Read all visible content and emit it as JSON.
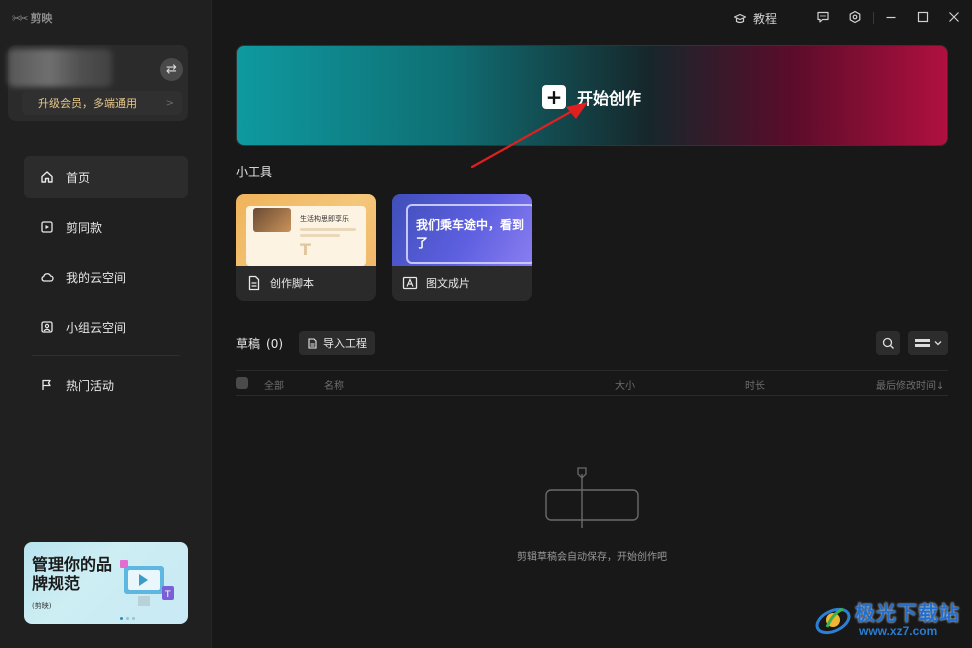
{
  "app": {
    "title": "剪映"
  },
  "account": {
    "upgrade_label": "升级会员，多端通用",
    "upgrade_chevron": ">",
    "switch_symbol": "⇄"
  },
  "nav": {
    "items": [
      {
        "label": "首页",
        "icon": "home-icon",
        "active": true
      },
      {
        "label": "剪同款",
        "icon": "template-icon",
        "active": false
      },
      {
        "label": "我的云空间",
        "icon": "cloud-icon",
        "active": false
      },
      {
        "label": "小组云空间",
        "icon": "group-cloud-icon",
        "active": false
      },
      {
        "label": "热门活动",
        "icon": "flag-icon",
        "active": false
      }
    ]
  },
  "promo": {
    "title": "管理你的品牌规范",
    "subtitle": "(剪映)"
  },
  "titlebar": {
    "tutorial_label": "教程"
  },
  "hero": {
    "label": "开始创作"
  },
  "tools": {
    "title": "小工具",
    "items": [
      {
        "label": "创作脚本",
        "thumb_text": "生活构思即享乐",
        "icon": "document-icon"
      },
      {
        "label": "图文成片",
        "thumb_text": "我们乘车途中，看到了",
        "icon": "image-text-icon"
      }
    ]
  },
  "drafts": {
    "title": "草稿",
    "count": "(0)",
    "import_label": "导入工程",
    "columns": {
      "all": "全部",
      "name": "名称",
      "size": "大小",
      "duration": "时长",
      "modified": "最后修改时间↓"
    },
    "empty_message": "剪辑草稿会自动保存，开始创作吧"
  },
  "watermark": {
    "title": "极光下载站",
    "url": "www.xz7.com"
  },
  "colors": {
    "background": "#181818",
    "sidebar": "#202020",
    "hero_start": "#0e9aa0",
    "hero_end": "#b0103f",
    "arrow": "#e02020"
  }
}
